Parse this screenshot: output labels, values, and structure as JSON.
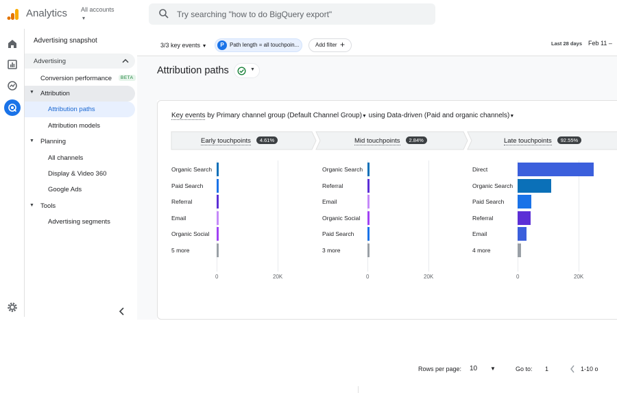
{
  "app": {
    "title": "Analytics",
    "account_label": "All accounts",
    "account_caret": "▾"
  },
  "search": {
    "placeholder": "Try searching \"how to do BigQuery export\""
  },
  "nav": {
    "snapshot": "Advertising snapshot",
    "section": "Advertising",
    "conversion": "Conversion performance",
    "beta": "BETA",
    "attribution": "Attribution",
    "attribution_paths": "Attribution paths",
    "attribution_models": "Attribution models",
    "planning": "Planning",
    "all_channels": "All channels",
    "display_video": "Display & Video 360",
    "google_ads": "Google Ads",
    "tools": "Tools",
    "advertising_segments": "Advertising segments"
  },
  "filters": {
    "key_events": "3/3 key events",
    "path_chip_letter": "P",
    "path_chip": "Path length = all touchpoin...",
    "add_filter": "Add filter",
    "date_range_label": "Last 28 days",
    "date_range_value": "Feb 11 –"
  },
  "page": {
    "title": "Attribution paths"
  },
  "card": {
    "key_events": "Key events",
    "by": "by",
    "dimension": "Primary channel group (Default Channel Group)",
    "using": "using",
    "model": "Data-driven (Paid and organic channels)"
  },
  "segments": [
    {
      "label": "Early touchpoints",
      "pct": "4.61%"
    },
    {
      "label": "Mid touchpoints",
      "pct": "2.84%"
    },
    {
      "label": "Late touchpoints",
      "pct": "92.55%"
    }
  ],
  "chart_data": [
    {
      "type": "bar",
      "orientation": "horizontal",
      "categories": [
        "Organic Search",
        "Paid Search",
        "Referral",
        "Email",
        "Organic Social",
        "5 more"
      ],
      "values": [
        600,
        450,
        250,
        80,
        80,
        60
      ],
      "xlim": [
        0,
        20000
      ],
      "xticks": [
        "0",
        "20K"
      ],
      "colors": [
        "#0b70b8",
        "#1a73e8",
        "#5c2fd6",
        "#c58af9",
        "#a142f4",
        "#9aa0a6"
      ]
    },
    {
      "type": "bar",
      "orientation": "horizontal",
      "categories": [
        "Organic Search",
        "Referral",
        "Email",
        "Organic Social",
        "Paid Search",
        "3 more"
      ],
      "values": [
        450,
        120,
        80,
        60,
        50,
        40
      ],
      "xlim": [
        0,
        20000
      ],
      "xticks": [
        "0",
        "20K"
      ],
      "colors": [
        "#0b70b8",
        "#5c2fd6",
        "#c58af9",
        "#a142f4",
        "#1a73e8",
        "#9aa0a6"
      ]
    },
    {
      "type": "bar",
      "orientation": "horizontal",
      "categories": [
        "Direct",
        "Organic Search",
        "Paid Search",
        "Referral",
        "Email",
        "4 more"
      ],
      "values": [
        25000,
        11000,
        4500,
        4200,
        3000,
        1200
      ],
      "xlim": [
        0,
        20000
      ],
      "xticks": [
        "0",
        "20K"
      ],
      "colors": [
        "#3b5fdc",
        "#0b70b8",
        "#1a73e8",
        "#5c2fd6",
        "#3b5fdc",
        "#9aa0a6"
      ]
    }
  ],
  "footer": {
    "rows_label": "Rows per page:",
    "rows_value": "10",
    "goto_label": "Go to:",
    "goto_value": "1",
    "range": "1-10 o"
  }
}
